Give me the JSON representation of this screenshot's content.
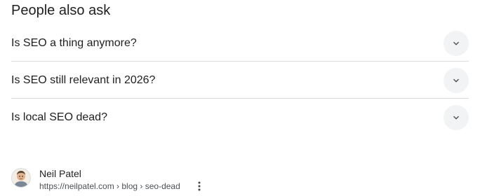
{
  "paa": {
    "title": "People also ask",
    "items": [
      {
        "question": "Is SEO a thing anymore?"
      },
      {
        "question": "Is SEO still relevant in 2026?"
      },
      {
        "question": "Is local SEO dead?"
      }
    ]
  },
  "result": {
    "site_name": "Neil Patel",
    "url": "https://neilpatel.com › blog › seo-dead"
  },
  "colors": {
    "divider": "#dadce0",
    "toggle_bg": "#f1f3f4",
    "chevron": "#474747"
  }
}
